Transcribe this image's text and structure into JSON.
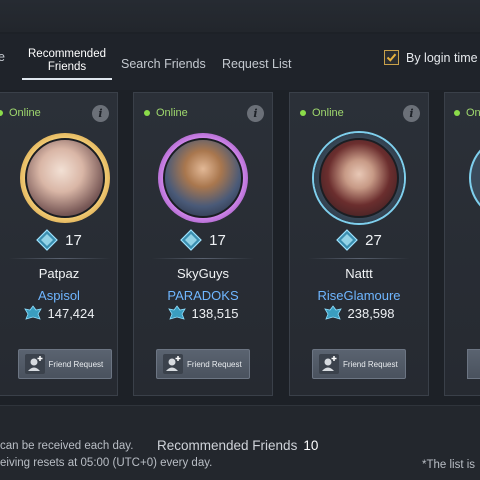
{
  "tabs": {
    "partial_left": "e",
    "recommended_line1": "Recommended",
    "recommended_line2": "Friends",
    "search": "Search Friends",
    "requests": "Request List"
  },
  "sort": {
    "label": "By login time",
    "checked": true
  },
  "cards": [
    {
      "status": "Online",
      "level": "17",
      "name": "Patpaz",
      "guild": "Aspisol",
      "power": "147,424",
      "button": "Friend Request",
      "frame_color": "#d9a33a"
    },
    {
      "status": "Online",
      "level": "17",
      "name": "SkyGuys",
      "guild": "PARADOKS",
      "power": "138,515",
      "button": "Friend Request",
      "frame_color": "#b25bd6"
    },
    {
      "status": "Online",
      "level": "27",
      "name": "Nattt",
      "guild": "RiseGlamoure",
      "power": "238,598",
      "button": "Friend Request",
      "frame_color": "#6fb8d8"
    },
    {
      "status": "Onl",
      "frame_color": "#6fb8d8"
    }
  ],
  "footer": {
    "note_line1": "can be received each day.",
    "note_line2": "eiving resets at 05:00 (UTC+0) every day.",
    "recommended_label": "Recommended Friends",
    "recommended_count": "10",
    "list_note": "*The list is"
  },
  "icons": {
    "info": "info-icon",
    "level": "level-diamond-icon",
    "power": "combat-power-icon",
    "friend_add": "add-friend-icon",
    "check": "check-icon"
  },
  "colors": {
    "online": "#8bdc4a",
    "guild": "#6fb6ff",
    "checkbox": "#c9a14a"
  }
}
